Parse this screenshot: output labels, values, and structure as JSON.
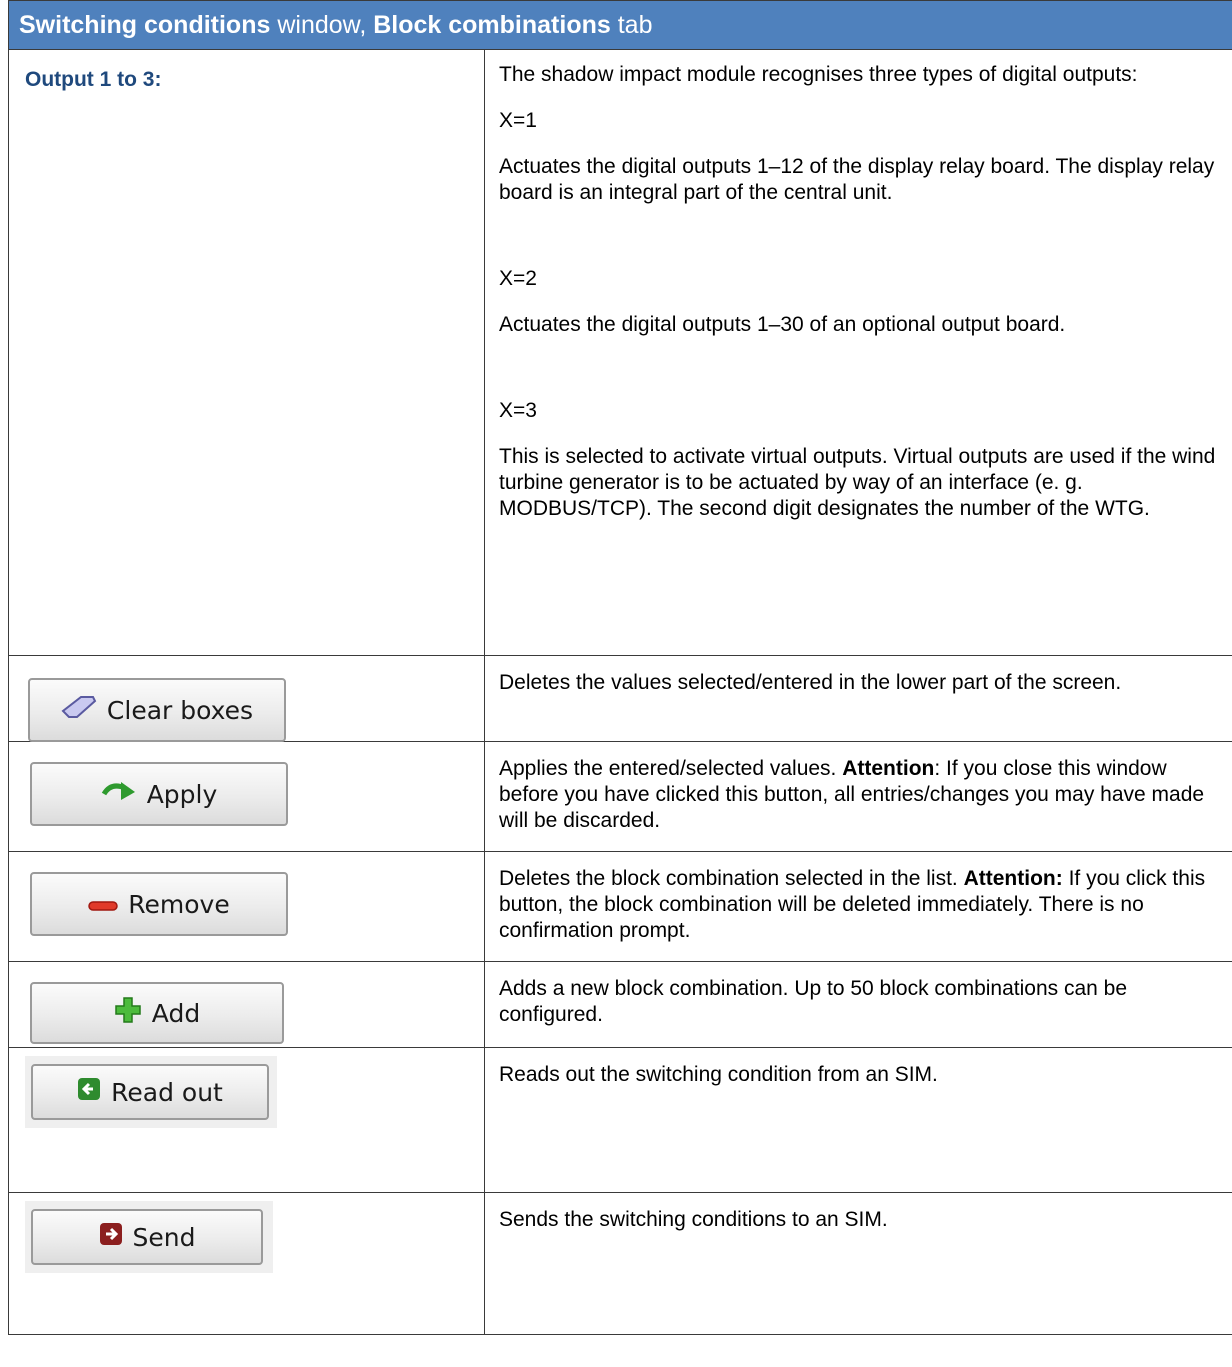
{
  "header": {
    "part1": "Switching conditions",
    "part2": " window, ",
    "part3": "Block combinations",
    "part4": " tab"
  },
  "output_row": {
    "label": "Output 1 to 3:",
    "intro": "The shadow impact module recognises three types of digital outputs:",
    "x1_label": "X=1",
    "x1_text": "Actuates the digital outputs 1–12 of the display relay board. The display relay board is an integral part of the central unit.",
    "x2_label": "X=2",
    "x2_text": "Actuates the digital outputs 1–30 of an optional output board.",
    "x3_label": "X=3",
    "x3_text": "This is selected to activate virtual outputs. Virtual outputs are used if the wind turbine generator is to be actuated by way of an interface (e. g. MODBUS/TCP). The second digit designates the number of the WTG."
  },
  "rows": {
    "clear": {
      "button_label": "Clear boxes",
      "icon": "eraser-icon",
      "text": "Deletes the values selected/entered in the lower part of the screen."
    },
    "apply": {
      "button_label": "Apply",
      "icon": "green-arrow-icon",
      "text_a": "Applies the entered/selected values. ",
      "text_bold": "Attention",
      "text_b": ": If you close this window before you have clicked this button, all entries/changes you may have made will be discarded."
    },
    "remove": {
      "button_label": "Remove",
      "icon": "red-minus-icon",
      "text_a": "Deletes the block combination selected in the list. ",
      "text_bold": "Attention:",
      "text_b": " If you click this button, the block combination will be deleted immediately. There is no confirmation prompt."
    },
    "add": {
      "button_label": "Add",
      "icon": "green-plus-icon",
      "text": "Adds a new block combination. Up to 50 block combinations can be configured."
    },
    "readout": {
      "button_label": "Read out",
      "icon": "green-back-arrow-icon",
      "text": "Reads out the switching condition from an SIM."
    },
    "send": {
      "button_label": "Send",
      "icon": "red-forward-arrow-icon",
      "text": "Sends the switching conditions to an SIM."
    }
  }
}
